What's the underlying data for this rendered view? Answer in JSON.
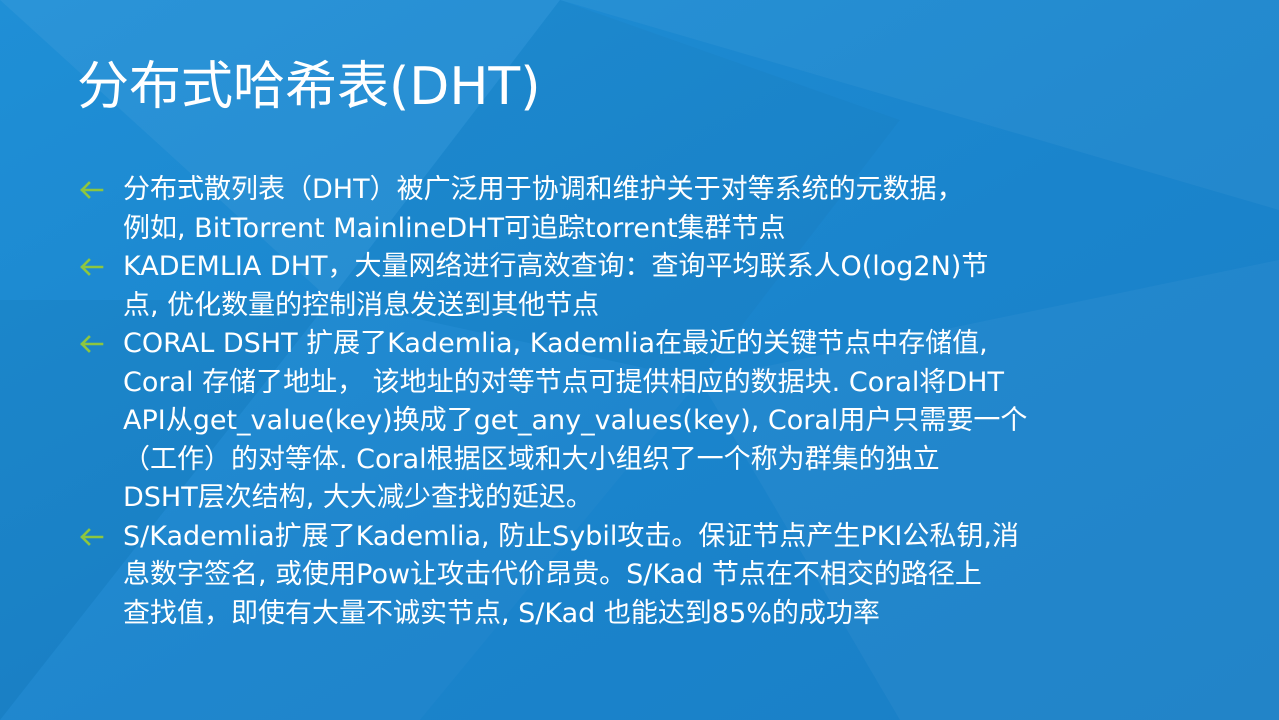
{
  "slide": {
    "title": "分布式哈希表(DHT)",
    "accent_color": "#8dc63f",
    "background_color": "#1a86cf",
    "bullet_icon": "arrow-left-icon",
    "bullets": [
      {
        "lines": [
          "分布式散列表（DHT）被广泛用于协调和维护关于对等系统的元数据，",
          "例如, BitTorrent MainlineDHT可追踪torrent集群节点"
        ]
      },
      {
        "lines": [
          "KADEMLIA DHT，大量网络进行高效查询：查询平均联系人O(log2N)节",
          "点, 优化数量的控制消息发送到其他节点"
        ]
      },
      {
        "lines": [
          "CORAL DSHT 扩展了Kademlia, Kademlia在最近的关键节点中存储值,",
          "Coral 存储了地址， 该地址的对等节点可提供相应的数据块. Coral将DHT",
          "API从get_value(key)换成了get_any_values(key), Coral用户只需要一个",
          "（工作）的对等体. Coral根据区域和大小组织了一个称为群集的独立",
          "DSHT层次结构, 大大减少查找的延迟。"
        ]
      },
      {
        "lines": [
          "S/Kademlia扩展了Kademlia, 防止Sybil攻击。保证节点产生PKI公私钥,消",
          "息数字签名, 或使用Pow让攻击代价昂贵。S/Kad 节点在不相交的路径上",
          "查找值，即使有大量不诚实节点, S/Kad 也能达到85%的成功率"
        ]
      }
    ]
  }
}
